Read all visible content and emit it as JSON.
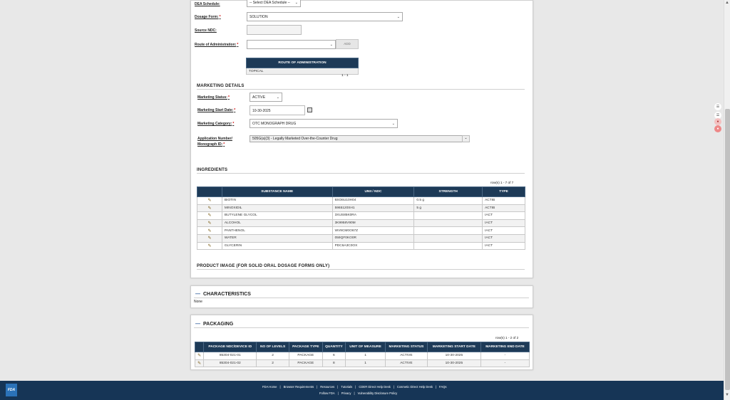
{
  "product": {
    "dea_schedule": {
      "label": "DEA Schedule:",
      "value": "-- Select DEA Schedule --"
    },
    "dosage_form": {
      "label": "Dosage Form:",
      "value": "SOLUTION"
    },
    "source_ndc": {
      "label": "Source NDC:",
      "value": ""
    },
    "route": {
      "label": "Route of Administration:",
      "value": "",
      "add_label": "ADD"
    },
    "route_table": {
      "header": "ROUTE OF ADMINISTRATION",
      "rows": [
        "TOPICAL"
      ],
      "pager": "1 - 1"
    }
  },
  "marketing": {
    "title": "MARKETING DETAILS",
    "status": {
      "label": "Marketing Status:",
      "value": "ACTIVE"
    },
    "start_date": {
      "label": "Marketing Start Date:",
      "value": "10-30-2025"
    },
    "category": {
      "label": "Marketing Category:",
      "value": "OTC MONOGRAPH DRUG"
    },
    "app_number": {
      "label1": "Application Number/",
      "label2": "Monograph ID:",
      "value": "505G(a)(3) - Legally Marketed Over-the-Counter Drug"
    }
  },
  "ingredients": {
    "title": "INGREDIENTS",
    "pager": "row(s) 1 - 7 of 7",
    "columns": [
      "SUBSTANCE NAME",
      "UNII / NDC",
      "STRENGTH",
      "TYPE"
    ],
    "rows": [
      [
        "BIOTIN",
        "6SO6U10H04",
        "0.5 g",
        "ACTIB"
      ],
      [
        "MINOXIDIL",
        "5965120SH1",
        "5 g",
        "ACTIB"
      ],
      [
        "BUTYLENE GLYCOL",
        "3XUS85K0RA",
        "",
        "IACT"
      ],
      [
        "ALCOHOL",
        "3K9958V90M",
        "",
        "IACT"
      ],
      [
        "PANTHENOL",
        "WV9CM0O67Z",
        "",
        "IACT"
      ],
      [
        "WATER",
        "059QF0KO0R",
        "",
        "IACT"
      ],
      [
        "GLYCERIN",
        "PDC6A3C0OX",
        "",
        "IACT"
      ]
    ]
  },
  "product_image": {
    "title": "PRODUCT IMAGE (FOR SOLID ORAL DOSAGE FORMS ONLY)"
  },
  "characteristics": {
    "title": "CHARACTERISTICS",
    "value": "None"
  },
  "packaging": {
    "title": "PACKAGING",
    "pager": "row(s) 1 - 2 of 2",
    "columns": [
      "PACKAGE NDC/DEVICE ID",
      "NO OF LEVELS",
      "PACKAGE TYPE",
      "QUANTITY",
      "UNIT OF MEASURE",
      "MARKETING STATUS",
      "MARKETING START DATE",
      "MARKETING END DATE"
    ],
    "rows": [
      [
        "85304-021-01",
        "2",
        "PACKAGE",
        "6",
        "1",
        "ACTIVE",
        "10-30-2025",
        "-"
      ],
      [
        "85304-021-02",
        "2",
        "PACKAGE",
        "8",
        "1",
        "ACTIVE",
        "10-30-2025",
        "-"
      ]
    ]
  },
  "footer": {
    "logo": "FDA",
    "links_row1": [
      "FDA Home",
      "Browser Requirements",
      "Resources",
      "Tutorials",
      "CDER Direct Help Desk",
      "Cosmetic Direct Help Desk",
      "FAQs"
    ],
    "links_row2": [
      "Follow FDA",
      "Privacy",
      "Vulnerability Disclosure Policy"
    ]
  },
  "icons": {
    "edit": "pencil-icon",
    "calendar": "calendar-icon",
    "collapse": "minus-icon"
  }
}
